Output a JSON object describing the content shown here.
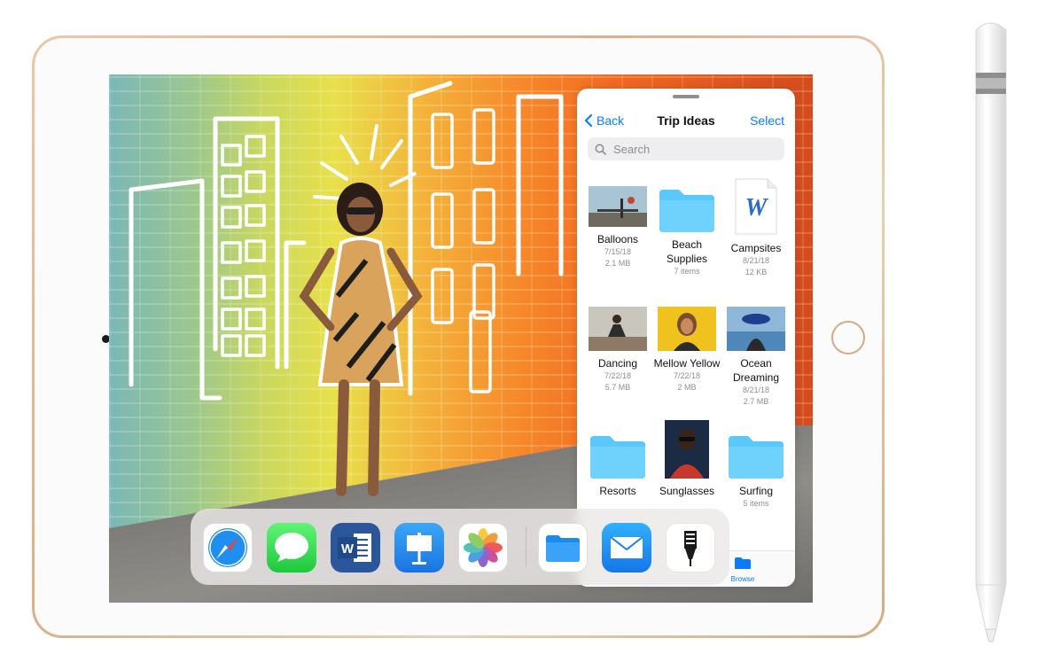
{
  "files_panel": {
    "back_label": "Back",
    "title": "Trip Ideas",
    "select_label": "Select",
    "search_placeholder": "Search",
    "items": [
      {
        "name": "Balloons",
        "meta": [
          "7/15/18",
          "2.1 MB"
        ],
        "kind": "photo"
      },
      {
        "name": "Beach Supplies",
        "meta": [
          "7 items"
        ],
        "kind": "folder"
      },
      {
        "name": "Campsites",
        "meta": [
          "8/21/18",
          "12 KB"
        ],
        "kind": "word-doc"
      },
      {
        "name": "Dancing",
        "meta": [
          "7/22/18",
          "5.7 MB"
        ],
        "kind": "photo"
      },
      {
        "name": "Mellow Yellow",
        "meta": [
          "7/22/18",
          "2 MB"
        ],
        "kind": "photo"
      },
      {
        "name": "Ocean Dreaming",
        "meta": [
          "8/21/18",
          "2.7 MB"
        ],
        "kind": "photo"
      },
      {
        "name": "Resorts",
        "meta": [],
        "kind": "folder"
      },
      {
        "name": "Sunglasses",
        "meta": [],
        "kind": "photo"
      },
      {
        "name": "Surfing",
        "meta": [
          "5 items"
        ],
        "kind": "folder"
      }
    ],
    "tab_browse_label": "Browse"
  },
  "dock": {
    "apps": [
      "safari-icon",
      "messages-icon",
      "word-icon",
      "keynote-icon",
      "photos-icon",
      "files-icon",
      "mail-icon",
      "drawing-app-icon"
    ]
  },
  "colors": {
    "ios_blue": "#0a7aff",
    "gold_bezel": "#d9b08a",
    "folder_blue": "#5ac8fa"
  }
}
